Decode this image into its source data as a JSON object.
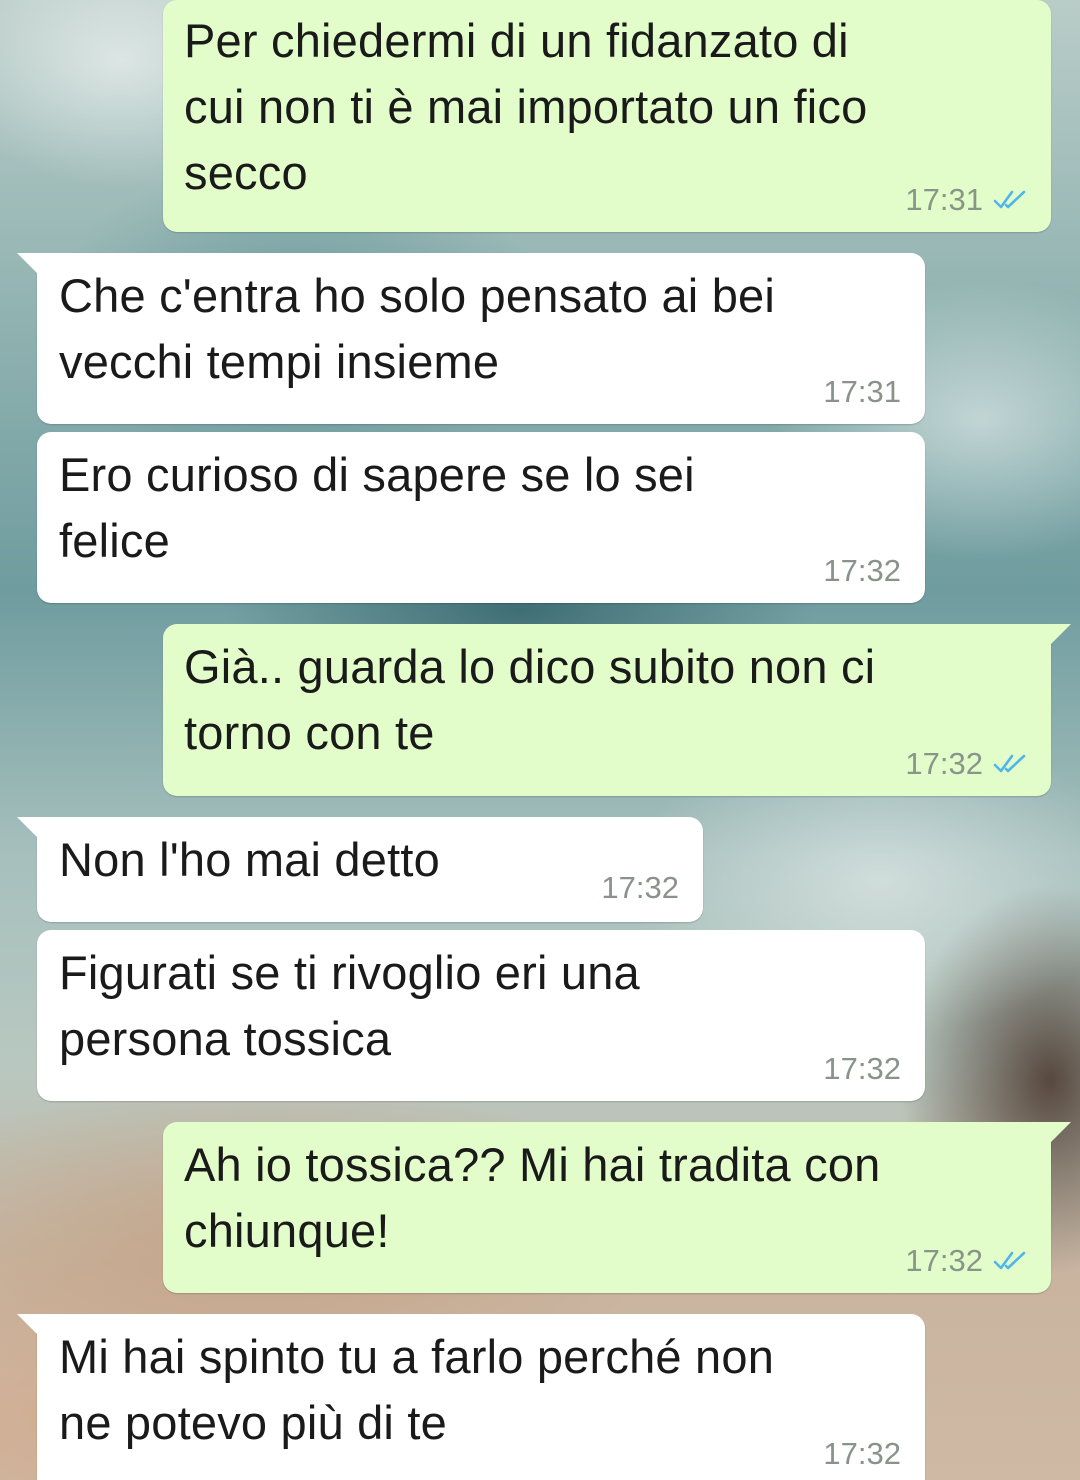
{
  "chat": {
    "messages": [
      {
        "direction": "outgoing",
        "lines": [
          "Per chiedermi di un fidanzato di",
          "cui non ti è mai importato un fico",
          "secco"
        ],
        "time": "17:31",
        "read": true
      },
      {
        "direction": "incoming",
        "lines": [
          "Che c'entra ho solo pensato ai bei",
          "vecchi tempi insieme"
        ],
        "time": "17:31"
      },
      {
        "direction": "incoming",
        "lines": [
          "Ero curioso di sapere se lo sei",
          "felice"
        ],
        "time": "17:32"
      },
      {
        "direction": "outgoing",
        "lines": [
          "Già.. guarda lo dico subito non ci",
          "torno con te"
        ],
        "time": "17:32",
        "read": true
      },
      {
        "direction": "incoming",
        "lines": [
          "Non l'ho mai detto"
        ],
        "time": "17:32"
      },
      {
        "direction": "incoming",
        "lines": [
          "Figurati se ti rivoglio eri una",
          "persona tossica"
        ],
        "time": "17:32"
      },
      {
        "direction": "outgoing",
        "lines": [
          "Ah io tossica?? Mi hai tradita con",
          "chiunque!"
        ],
        "time": "17:32",
        "read": true
      },
      {
        "direction": "incoming",
        "lines": [
          "Mi hai spinto tu a farlo perché non",
          "ne potevo più di te"
        ],
        "time": "17:32"
      }
    ]
  },
  "colors": {
    "outgoing_bubble": "#e2fdc9",
    "incoming_bubble": "#ffffff",
    "read_ticks": "#4fb6ec",
    "timestamp": "#8a928c"
  },
  "icons": {
    "read_receipt": "double-check-icon"
  }
}
